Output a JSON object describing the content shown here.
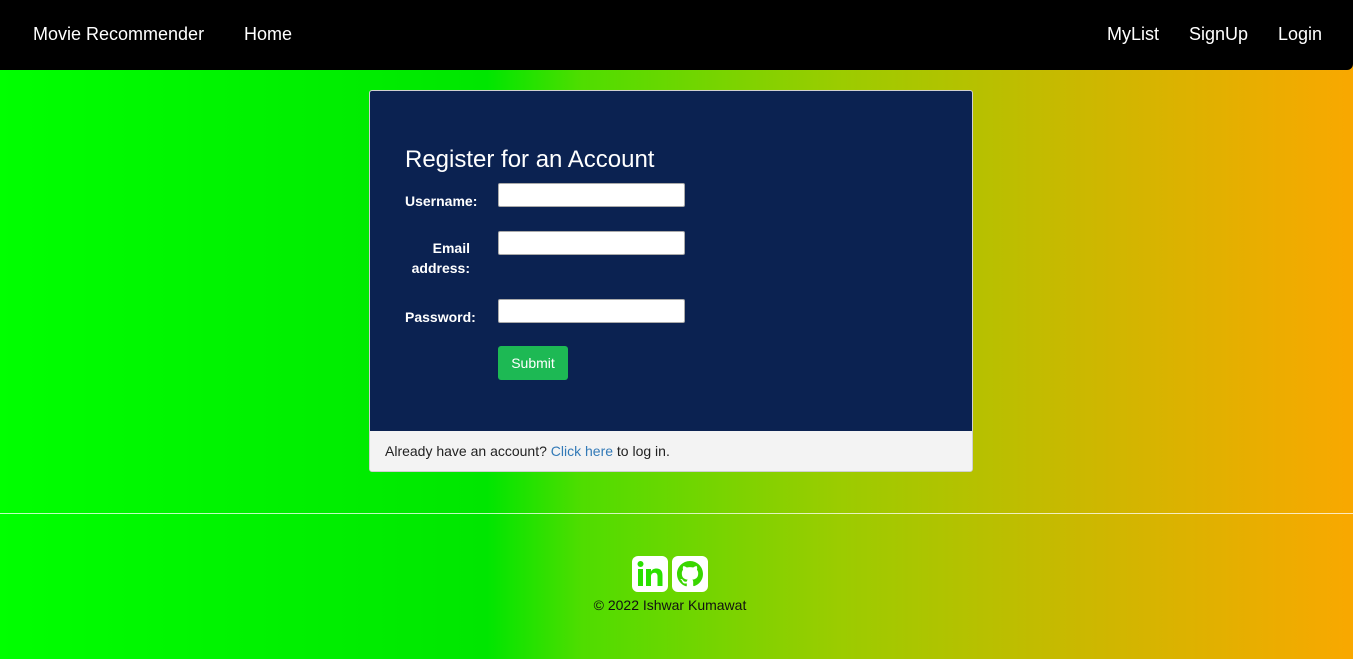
{
  "navbar": {
    "brand": "Movie Recommender",
    "home": "Home",
    "mylist": "MyList",
    "signup": "SignUp",
    "login": "Login"
  },
  "form": {
    "title": "Register for an Account",
    "username_label": "Username:",
    "email_label": "Email address:",
    "password_label": "Password:",
    "username_value": "",
    "email_value": "",
    "password_value": "",
    "submit_label": "Submit"
  },
  "footer_panel": {
    "prefix": "Already have an account?",
    "link_text": "Click here",
    "suffix": "to log in."
  },
  "footer": {
    "icons": [
      "linkedin-icon",
      "github-icon"
    ],
    "copyright": "© 2022 Ishwar Kumawat"
  },
  "colors": {
    "navbar": "#000000",
    "panel_body": "#0b2251",
    "submit": "#1db954",
    "link": "#337ab7"
  }
}
